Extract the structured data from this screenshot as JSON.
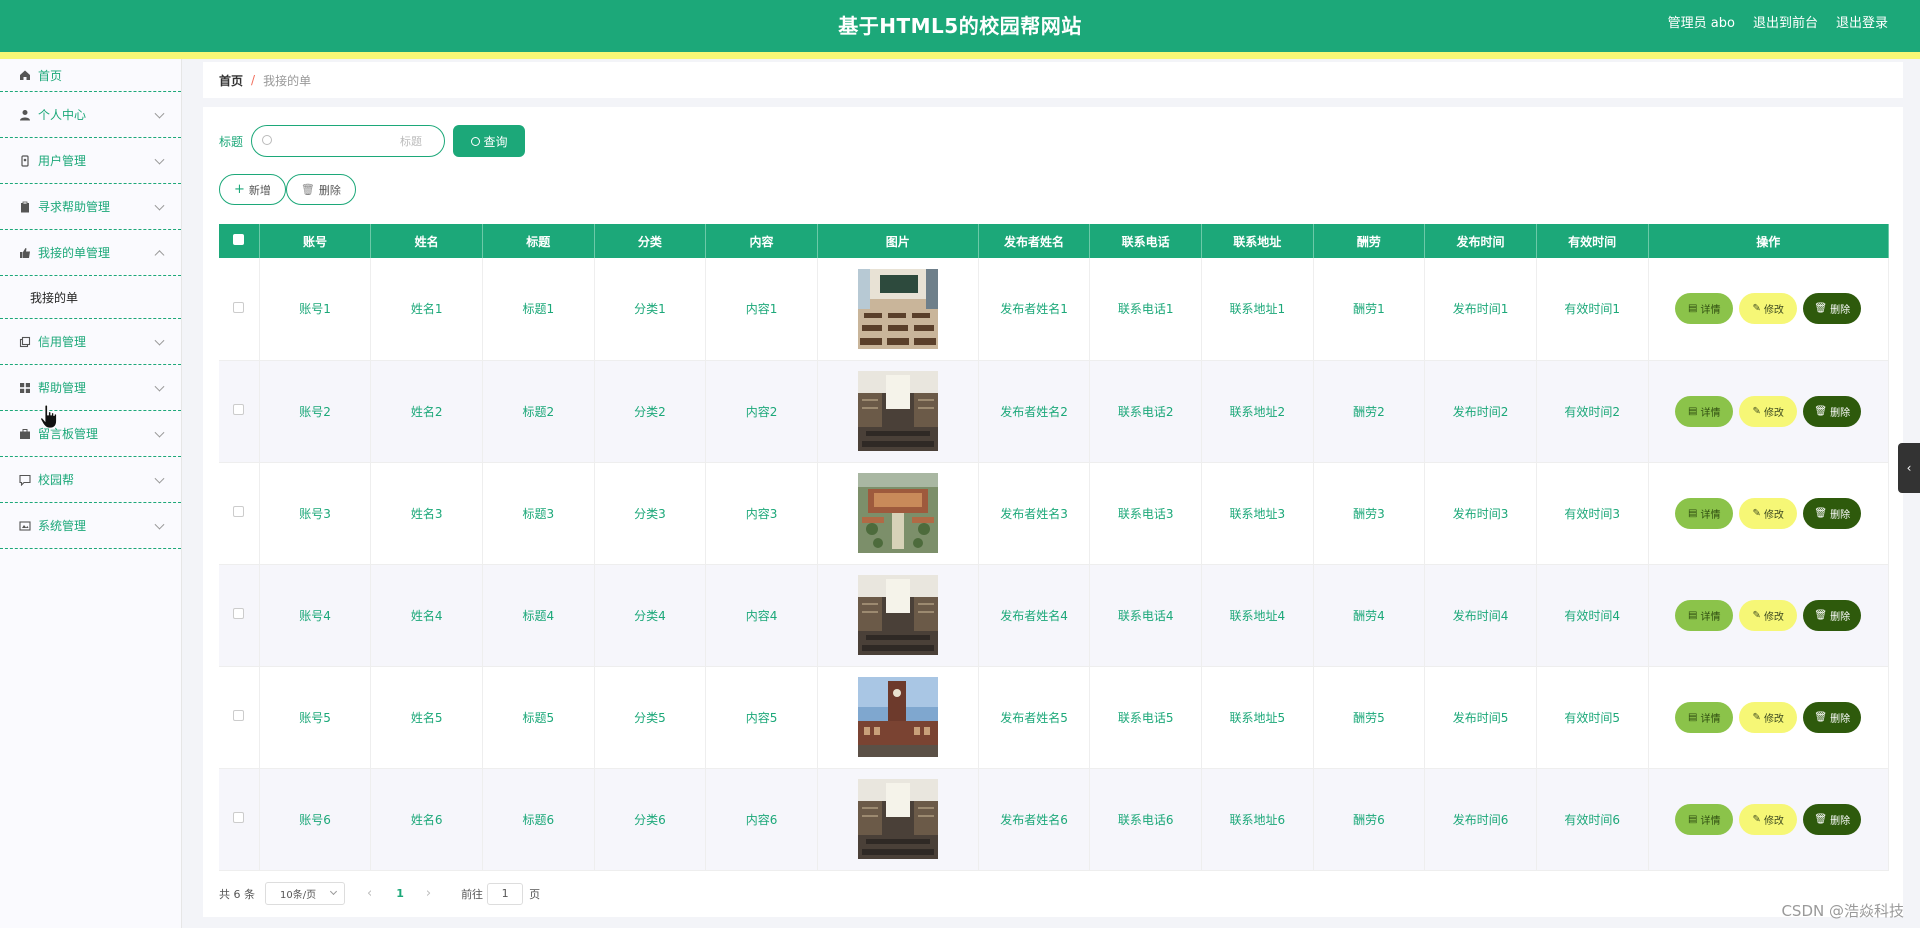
{
  "header": {
    "title": "基于HTML5的校园帮网站",
    "links": [
      "管理员 abo",
      "退出到前台",
      "退出登录"
    ]
  },
  "sidebar": {
    "items": [
      {
        "label": "首页",
        "icon": "home-icon"
      },
      {
        "label": "个人中心",
        "icon": "user-icon"
      },
      {
        "label": "用户管理",
        "icon": "user-badge-icon"
      },
      {
        "label": "寻求帮助管理",
        "icon": "clipboard-icon"
      },
      {
        "label": "我接的单管理",
        "icon": "thumb-up-icon",
        "expanded": true,
        "children": [
          "我接的单"
        ]
      },
      {
        "label": "信用管理",
        "icon": "copy-icon"
      },
      {
        "label": "帮助管理",
        "icon": "grid-icon"
      },
      {
        "label": "留言板管理",
        "icon": "briefcase-icon"
      },
      {
        "label": "校园帮",
        "icon": "chat-icon"
      },
      {
        "label": "系统管理",
        "icon": "settings-image-icon"
      }
    ]
  },
  "breadcrumb": {
    "home": "首页",
    "separator": "/",
    "current": "我接的单"
  },
  "search": {
    "label": "标题",
    "placeholder": "标题",
    "value": "",
    "button": "查询"
  },
  "actions": {
    "add": "新增",
    "delete": "删除"
  },
  "table": {
    "columns": [
      "账号",
      "姓名",
      "标题",
      "分类",
      "内容",
      "图片",
      "发布者姓名",
      "联系电话",
      "联系地址",
      "酬劳",
      "发布时间",
      "有效时间",
      "操作"
    ],
    "rows": [
      {
        "account": "账号1",
        "name": "姓名1",
        "title": "标题1",
        "category": "分类1",
        "content": "内容1",
        "image": "classroom-photo",
        "publisher": "发布者姓名1",
        "phone": "联系电话1",
        "address": "联系地址1",
        "reward": "酬劳1",
        "pub_time": "发布时间1",
        "valid_time": "有效时间1"
      },
      {
        "account": "账号2",
        "name": "姓名2",
        "title": "标题2",
        "category": "分类2",
        "content": "内容2",
        "image": "library-photo",
        "publisher": "发布者姓名2",
        "phone": "联系电话2",
        "address": "联系地址2",
        "reward": "酬劳2",
        "pub_time": "发布时间2",
        "valid_time": "有效时间2"
      },
      {
        "account": "账号3",
        "name": "姓名3",
        "title": "标题3",
        "category": "分类3",
        "content": "内容3",
        "image": "campus-aerial-photo",
        "publisher": "发布者姓名3",
        "phone": "联系电话3",
        "address": "联系地址3",
        "reward": "酬劳3",
        "pub_time": "发布时间3",
        "valid_time": "有效时间3"
      },
      {
        "account": "账号4",
        "name": "姓名4",
        "title": "标题4",
        "category": "分类4",
        "content": "内容4",
        "image": "library-photo",
        "publisher": "发布者姓名4",
        "phone": "联系电话4",
        "address": "联系地址4",
        "reward": "酬劳4",
        "pub_time": "发布时间4",
        "valid_time": "有效时间4"
      },
      {
        "account": "账号5",
        "name": "姓名5",
        "title": "标题5",
        "category": "分类5",
        "content": "内容5",
        "image": "clock-tower-photo",
        "publisher": "发布者姓名5",
        "phone": "联系电话5",
        "address": "联系地址5",
        "reward": "酬劳5",
        "pub_time": "发布时间5",
        "valid_time": "有效时间5"
      },
      {
        "account": "账号6",
        "name": "姓名6",
        "title": "标题6",
        "category": "分类6",
        "content": "内容6",
        "image": "library-photo",
        "publisher": "发布者姓名6",
        "phone": "联系电话6",
        "address": "联系地址6",
        "reward": "酬劳6",
        "pub_time": "发布时间6",
        "valid_time": "有效时间6"
      }
    ],
    "row_actions": {
      "detail": "详情",
      "edit": "修改",
      "delete": "删除"
    }
  },
  "pagination": {
    "total": "共 6 条",
    "page_size": "10条/页",
    "current_page": "1",
    "goto_prefix": "前往",
    "goto_value": "1",
    "goto_suffix": "页"
  },
  "watermark": "CSDN @浩焱科技",
  "colors": {
    "primary": "#1ca879",
    "accent": "#f6f776",
    "detail": "#8bc34a",
    "edit": "#f6f776",
    "delete": "#2e5a0c"
  }
}
